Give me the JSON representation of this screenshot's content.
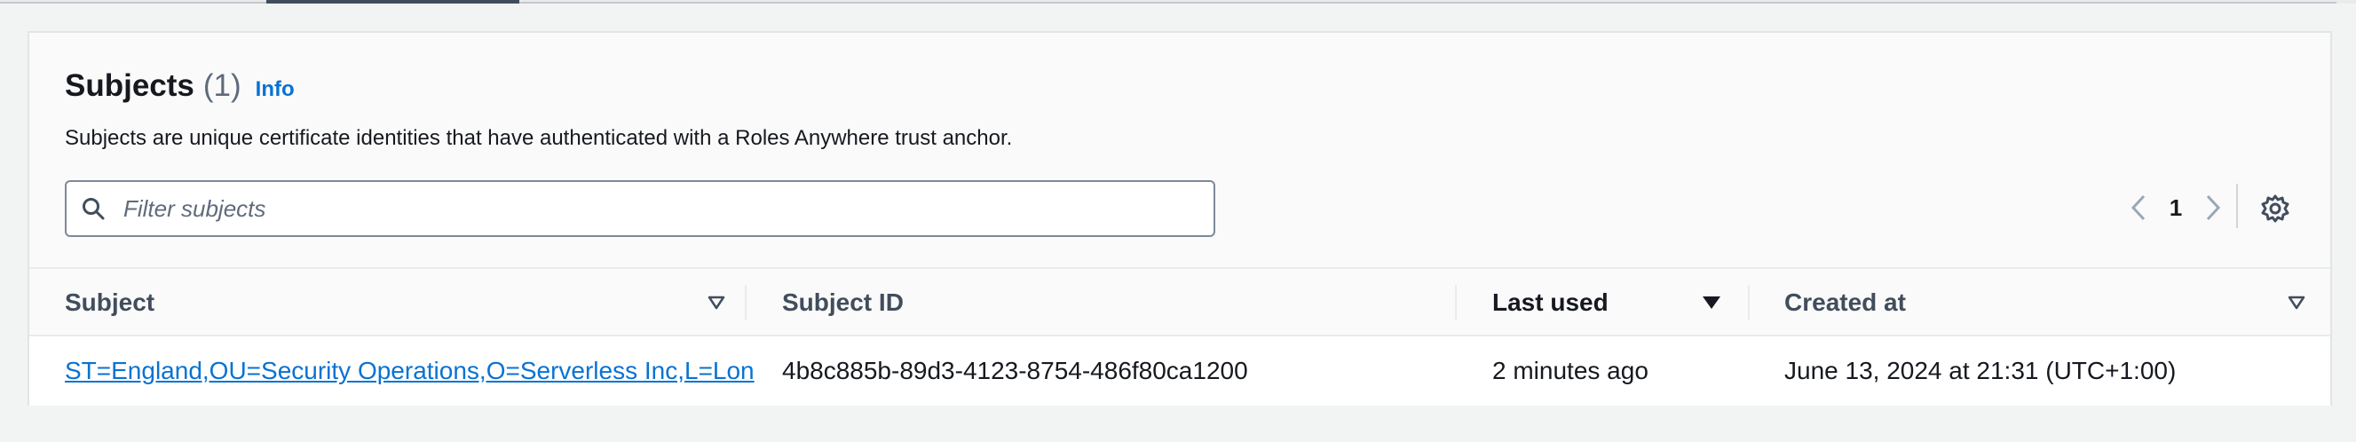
{
  "section": {
    "title": "Subjects",
    "count": "(1)",
    "info_link": "Info",
    "description": "Subjects are unique certificate identities that have authenticated with a Roles Anywhere trust anchor."
  },
  "filter": {
    "placeholder": "Filter subjects",
    "value": ""
  },
  "pagination": {
    "current_page": "1"
  },
  "table": {
    "columns": [
      {
        "label": "Subject",
        "sort": "unsorted"
      },
      {
        "label": "Subject ID",
        "sort": "none"
      },
      {
        "label": "Last used",
        "sort": "descending"
      },
      {
        "label": "Created at",
        "sort": "unsorted"
      }
    ],
    "rows": [
      {
        "subject": "ST=England,OU=Security Operations,O=Serverless Inc,L=Lon",
        "subject_id": "4b8c885b-89d3-4123-8754-486f80ca1200",
        "last_used": "2 minutes ago",
        "created_at": "June 13, 2024 at 21:31 (UTC+1:00)"
      }
    ]
  },
  "icons": {
    "search": "search-icon",
    "prev": "chevron-left-icon",
    "next": "chevron-right-icon",
    "settings": "gear-icon",
    "sort_unsorted": "caret-down-outline-icon",
    "sort_desc": "caret-down-filled-icon"
  },
  "colors": {
    "link": "#0972d3",
    "text": "#16191f",
    "muted": "#5f6b7a"
  }
}
